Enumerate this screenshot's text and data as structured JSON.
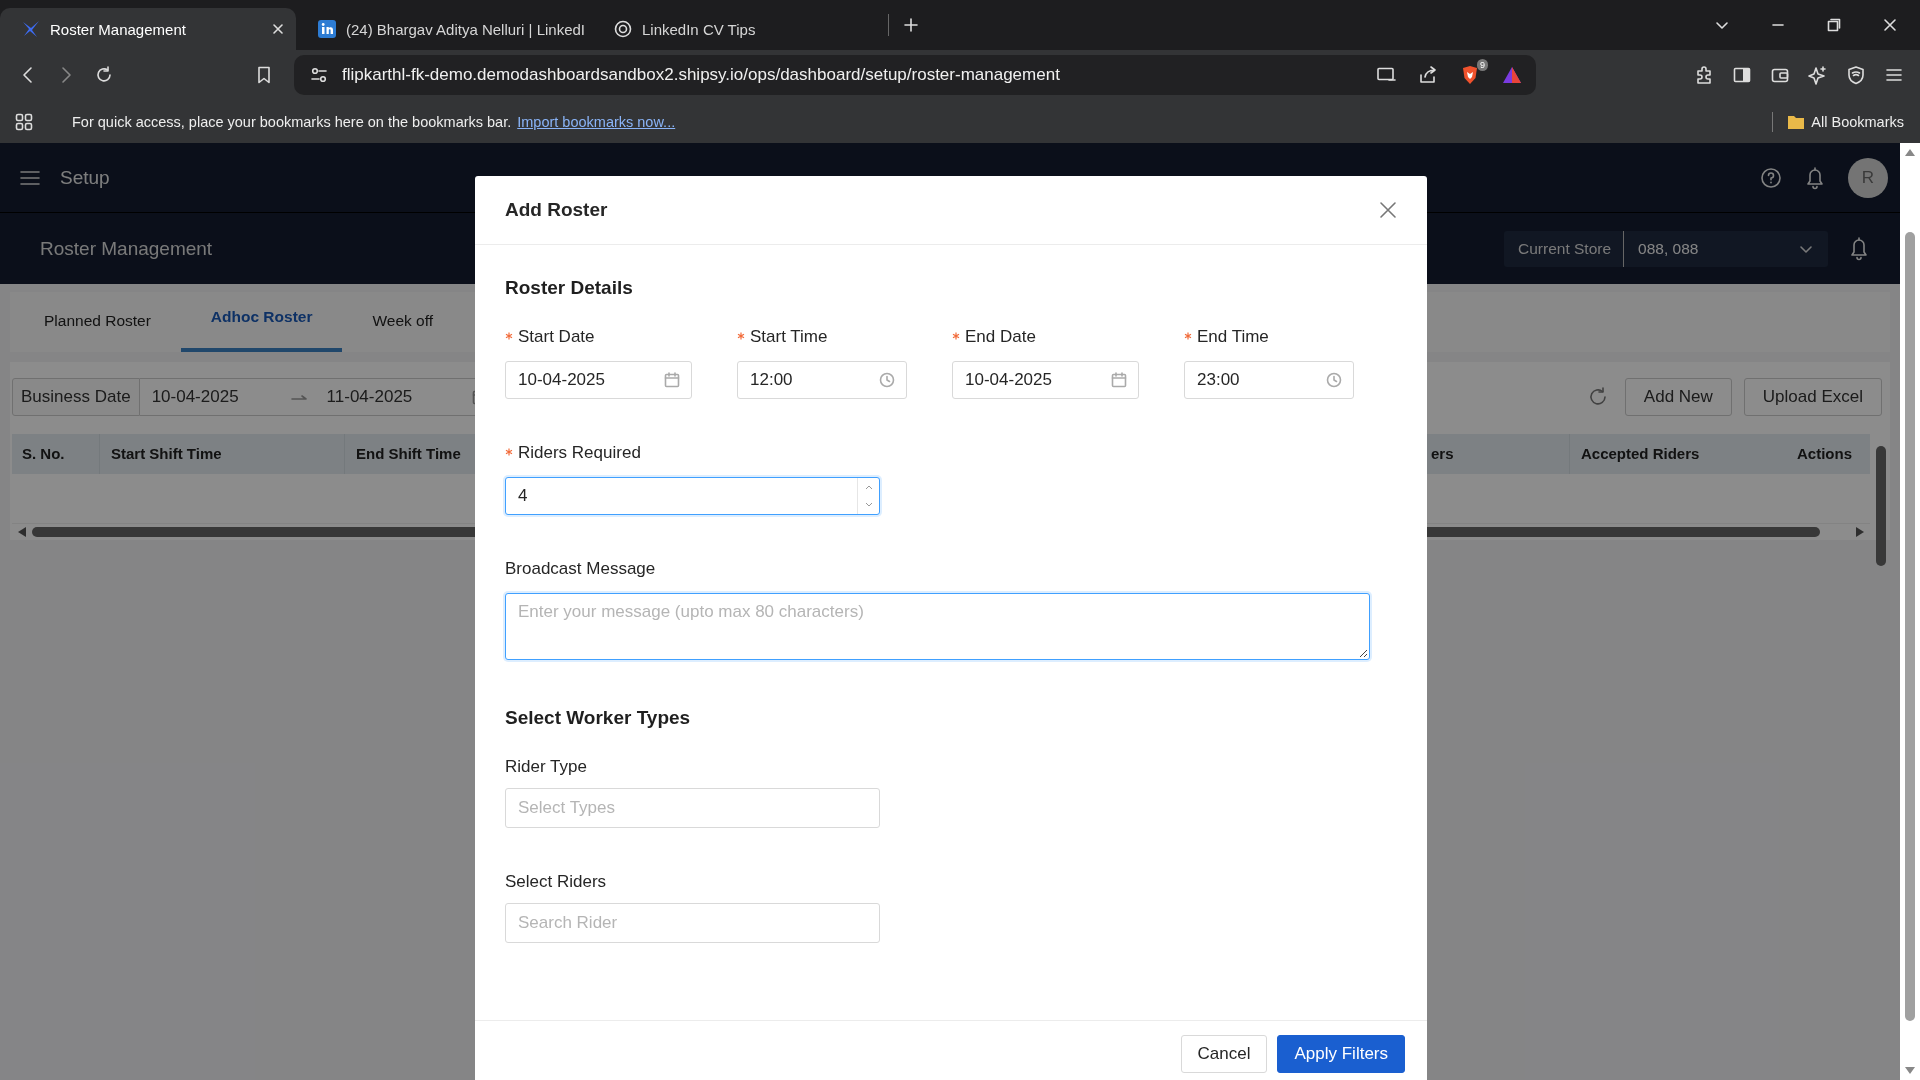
{
  "browser": {
    "tabs": [
      {
        "title": "Roster Management",
        "kind": "app",
        "selected": true
      },
      {
        "title": "(24) Bhargav Aditya Nelluri | LinkedI",
        "kind": "social",
        "selected": false
      },
      {
        "title": "LinkedIn CV Tips",
        "kind": "web",
        "selected": false
      }
    ],
    "url": "flipkarthl-fk-demo.demodashboardsandbox2.shipsy.io/ops/dashboard/setup/roster-management",
    "shield_badge": "9",
    "bookmarks_bar": {
      "message": "For quick access, place your bookmarks here on the bookmarks bar.",
      "link": "Import bookmarks now...",
      "all_bookmarks": "All Bookmarks"
    }
  },
  "app_header": {
    "title": "Setup",
    "avatar": "R"
  },
  "sub_header": {
    "title": "Roster Management",
    "store": {
      "label": "Current Store",
      "value": "088, 088"
    }
  },
  "tabs": [
    {
      "label": "Planned Roster",
      "selected": false
    },
    {
      "label": "Adhoc Roster",
      "selected": true
    },
    {
      "label": "Week off",
      "selected": false
    }
  ],
  "filters": {
    "label": "Business Date",
    "start": "10-04-2025",
    "end": "11-04-2025",
    "buttons": [
      "Add New",
      "Upload Excel"
    ]
  },
  "table": {
    "columns": [
      "S. No.",
      "Start Shift Time",
      "End Shift Time",
      "ers",
      "Accepted Riders",
      "Actions"
    ]
  },
  "modal": {
    "title": "Add Roster",
    "sections": [
      {
        "title": "Roster Details",
        "rows": [
          [
            {
              "label": "Start Date",
              "required": true,
              "kind": "date",
              "value": "10-04-2025",
              "focused": false
            },
            {
              "label": "Start Time",
              "required": true,
              "kind": "time",
              "value": "12:00",
              "focused": false
            },
            {
              "label": "End Date",
              "required": true,
              "kind": "date",
              "value": "10-04-2025",
              "focused": false
            },
            {
              "label": "End Time",
              "required": true,
              "kind": "time",
              "value": "23:00",
              "focused": false
            }
          ],
          [
            {
              "label": "Riders Required",
              "required": true,
              "kind": "number",
              "value": "4",
              "focused": true
            }
          ],
          [
            {
              "label": "Broadcast Message",
              "required": false,
              "kind": "textarea",
              "placeholder": "Enter your message (upto max 80 characters)",
              "focused": true
            }
          ]
        ]
      },
      {
        "title": "Select Worker Types",
        "rows": [
          [
            {
              "label": "Rider Type",
              "required": false,
              "kind": "select",
              "placeholder": "Select Types",
              "focused": false
            }
          ],
          [
            {
              "label": "Select Riders",
              "required": false,
              "kind": "search",
              "placeholder": "Search Rider",
              "focused": false
            }
          ]
        ]
      }
    ],
    "buttons": [
      {
        "label": "Cancel",
        "kind": "secondary"
      },
      {
        "label": "Apply Filters",
        "kind": "primary"
      }
    ]
  }
}
